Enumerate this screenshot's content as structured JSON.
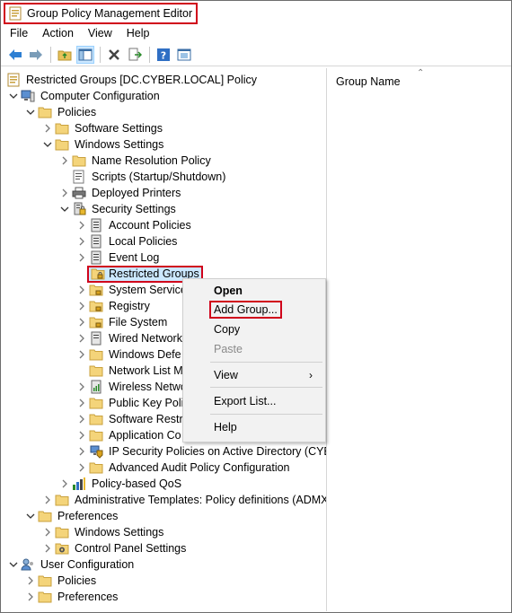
{
  "window": {
    "title": "Group Policy Management Editor"
  },
  "menubar": {
    "items": [
      "File",
      "Action",
      "View",
      "Help"
    ]
  },
  "tree": {
    "root": "Restricted Groups [DC.CYBER.LOCAL] Policy",
    "computer_config": "Computer Configuration",
    "policies": "Policies",
    "software_settings": "Software Settings",
    "windows_settings": "Windows Settings",
    "name_resolution_policy": "Name Resolution Policy",
    "scripts": "Scripts (Startup/Shutdown)",
    "deployed_printers": "Deployed Printers",
    "security_settings": "Security Settings",
    "account_policies": "Account Policies",
    "local_policies": "Local Policies",
    "event_log": "Event Log",
    "restricted_groups": "Restricted Groups",
    "system_services": "System Service",
    "registry": "Registry",
    "file_system": "File System",
    "wired_network": "Wired Network",
    "windows_defender": "Windows Defe",
    "network_list": "Network List M",
    "wireless_network": "Wireless Netwo",
    "public_key": "Public Key Poli",
    "software_restriction": "Software Restri",
    "application_control": "Application Co",
    "ip_security": "IP Security Policies on Active Directory (CYBE",
    "advanced_audit": "Advanced Audit Policy Configuration",
    "policy_qos": "Policy-based QoS",
    "admin_templates": "Administrative Templates: Policy definitions (ADMX",
    "preferences": "Preferences",
    "pref_windows_settings": "Windows Settings",
    "pref_control_panel": "Control Panel Settings",
    "user_config": "User Configuration",
    "user_policies": "Policies",
    "user_preferences": "Preferences"
  },
  "right_pane": {
    "column_header": "Group Name"
  },
  "context_menu": {
    "open": "Open",
    "add_group": "Add Group...",
    "copy": "Copy",
    "paste": "Paste",
    "view": "View",
    "export_list": "Export List...",
    "help": "Help"
  },
  "colors": {
    "highlight_border": "#d0021b",
    "selection_bg": "#cce8ff",
    "folder": "#e8c15a"
  }
}
